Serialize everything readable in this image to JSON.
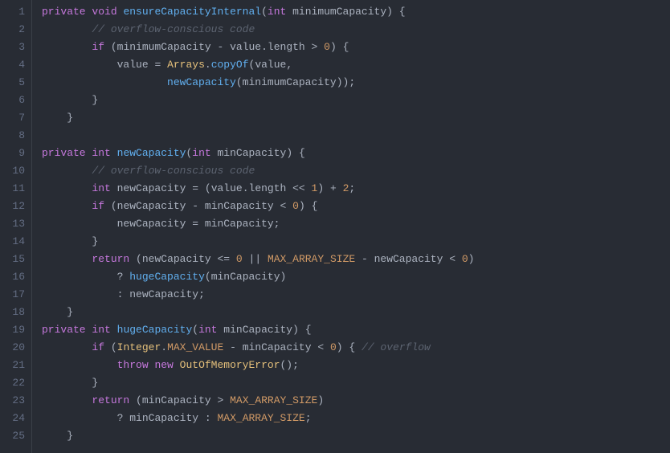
{
  "code": {
    "lines": [
      {
        "t": [
          {
            "c": "kw",
            "s": "private"
          },
          {
            "c": "",
            "s": " "
          },
          {
            "c": "kw",
            "s": "void"
          },
          {
            "c": "",
            "s": " "
          },
          {
            "c": "fn",
            "s": "ensureCapacityInternal"
          },
          {
            "c": "punc",
            "s": "("
          },
          {
            "c": "kw",
            "s": "int"
          },
          {
            "c": "",
            "s": " minimumCapacity"
          },
          {
            "c": "punc",
            "s": ")"
          },
          {
            "c": "",
            "s": " "
          },
          {
            "c": "punc",
            "s": "{"
          }
        ]
      },
      {
        "t": [
          {
            "c": "",
            "s": "        "
          },
          {
            "c": "cmt",
            "s": "// overflow-conscious code"
          }
        ]
      },
      {
        "t": [
          {
            "c": "",
            "s": "        "
          },
          {
            "c": "kw",
            "s": "if"
          },
          {
            "c": "",
            "s": " "
          },
          {
            "c": "punc",
            "s": "("
          },
          {
            "c": "",
            "s": "minimumCapacity "
          },
          {
            "c": "op",
            "s": "-"
          },
          {
            "c": "",
            "s": " value"
          },
          {
            "c": "punc",
            "s": "."
          },
          {
            "c": "",
            "s": "length "
          },
          {
            "c": "op",
            "s": ">"
          },
          {
            "c": "",
            "s": " "
          },
          {
            "c": "num",
            "s": "0"
          },
          {
            "c": "punc",
            "s": ")"
          },
          {
            "c": "",
            "s": " "
          },
          {
            "c": "punc",
            "s": "{"
          }
        ]
      },
      {
        "t": [
          {
            "c": "",
            "s": "            value "
          },
          {
            "c": "op",
            "s": "="
          },
          {
            "c": "",
            "s": " "
          },
          {
            "c": "typename",
            "s": "Arrays"
          },
          {
            "c": "punc",
            "s": "."
          },
          {
            "c": "fn",
            "s": "copyOf"
          },
          {
            "c": "punc",
            "s": "("
          },
          {
            "c": "",
            "s": "value"
          },
          {
            "c": "punc",
            "s": ","
          }
        ]
      },
      {
        "t": [
          {
            "c": "",
            "s": "                    "
          },
          {
            "c": "fn",
            "s": "newCapacity"
          },
          {
            "c": "punc",
            "s": "("
          },
          {
            "c": "",
            "s": "minimumCapacity"
          },
          {
            "c": "punc",
            "s": "))"
          },
          {
            "c": "punc",
            "s": ";"
          }
        ]
      },
      {
        "t": [
          {
            "c": "",
            "s": "        "
          },
          {
            "c": "punc",
            "s": "}"
          }
        ]
      },
      {
        "t": [
          {
            "c": "",
            "s": "    "
          },
          {
            "c": "punc",
            "s": "}"
          }
        ]
      },
      {
        "t": []
      },
      {
        "t": [
          {
            "c": "kw",
            "s": "private"
          },
          {
            "c": "",
            "s": " "
          },
          {
            "c": "kw",
            "s": "int"
          },
          {
            "c": "",
            "s": " "
          },
          {
            "c": "fn",
            "s": "newCapacity"
          },
          {
            "c": "punc",
            "s": "("
          },
          {
            "c": "kw",
            "s": "int"
          },
          {
            "c": "",
            "s": " minCapacity"
          },
          {
            "c": "punc",
            "s": ")"
          },
          {
            "c": "",
            "s": " "
          },
          {
            "c": "punc",
            "s": "{"
          }
        ]
      },
      {
        "t": [
          {
            "c": "",
            "s": "        "
          },
          {
            "c": "cmt",
            "s": "// overflow-conscious code"
          }
        ]
      },
      {
        "t": [
          {
            "c": "",
            "s": "        "
          },
          {
            "c": "kw",
            "s": "int"
          },
          {
            "c": "",
            "s": " newCapacity "
          },
          {
            "c": "op",
            "s": "="
          },
          {
            "c": "",
            "s": " "
          },
          {
            "c": "punc",
            "s": "("
          },
          {
            "c": "",
            "s": "value"
          },
          {
            "c": "punc",
            "s": "."
          },
          {
            "c": "",
            "s": "length "
          },
          {
            "c": "op",
            "s": "<<"
          },
          {
            "c": "",
            "s": " "
          },
          {
            "c": "num",
            "s": "1"
          },
          {
            "c": "punc",
            "s": ")"
          },
          {
            "c": "",
            "s": " "
          },
          {
            "c": "op",
            "s": "+"
          },
          {
            "c": "",
            "s": " "
          },
          {
            "c": "num",
            "s": "2"
          },
          {
            "c": "punc",
            "s": ";"
          }
        ]
      },
      {
        "t": [
          {
            "c": "",
            "s": "        "
          },
          {
            "c": "kw",
            "s": "if"
          },
          {
            "c": "",
            "s": " "
          },
          {
            "c": "punc",
            "s": "("
          },
          {
            "c": "",
            "s": "newCapacity "
          },
          {
            "c": "op",
            "s": "-"
          },
          {
            "c": "",
            "s": " minCapacity "
          },
          {
            "c": "op",
            "s": "<"
          },
          {
            "c": "",
            "s": " "
          },
          {
            "c": "num",
            "s": "0"
          },
          {
            "c": "punc",
            "s": ")"
          },
          {
            "c": "",
            "s": " "
          },
          {
            "c": "punc",
            "s": "{"
          }
        ]
      },
      {
        "t": [
          {
            "c": "",
            "s": "            newCapacity "
          },
          {
            "c": "op",
            "s": "="
          },
          {
            "c": "",
            "s": " minCapacity"
          },
          {
            "c": "punc",
            "s": ";"
          }
        ]
      },
      {
        "t": [
          {
            "c": "",
            "s": "        "
          },
          {
            "c": "punc",
            "s": "}"
          }
        ]
      },
      {
        "t": [
          {
            "c": "",
            "s": "        "
          },
          {
            "c": "kw",
            "s": "return"
          },
          {
            "c": "",
            "s": " "
          },
          {
            "c": "punc",
            "s": "("
          },
          {
            "c": "",
            "s": "newCapacity "
          },
          {
            "c": "op",
            "s": "<="
          },
          {
            "c": "",
            "s": " "
          },
          {
            "c": "num",
            "s": "0"
          },
          {
            "c": "",
            "s": " "
          },
          {
            "c": "op",
            "s": "||"
          },
          {
            "c": "",
            "s": " "
          },
          {
            "c": "const",
            "s": "MAX_ARRAY_SIZE"
          },
          {
            "c": "",
            "s": " "
          },
          {
            "c": "op",
            "s": "-"
          },
          {
            "c": "",
            "s": " newCapacity "
          },
          {
            "c": "op",
            "s": "<"
          },
          {
            "c": "",
            "s": " "
          },
          {
            "c": "num",
            "s": "0"
          },
          {
            "c": "punc",
            "s": ")"
          }
        ]
      },
      {
        "t": [
          {
            "c": "",
            "s": "            "
          },
          {
            "c": "op",
            "s": "?"
          },
          {
            "c": "",
            "s": " "
          },
          {
            "c": "fn",
            "s": "hugeCapacity"
          },
          {
            "c": "punc",
            "s": "("
          },
          {
            "c": "",
            "s": "minCapacity"
          },
          {
            "c": "punc",
            "s": ")"
          }
        ]
      },
      {
        "t": [
          {
            "c": "",
            "s": "            "
          },
          {
            "c": "op",
            "s": ":"
          },
          {
            "c": "",
            "s": " newCapacity"
          },
          {
            "c": "punc",
            "s": ";"
          }
        ]
      },
      {
        "t": [
          {
            "c": "",
            "s": "    "
          },
          {
            "c": "punc",
            "s": "}"
          }
        ]
      },
      {
        "t": [
          {
            "c": "kw",
            "s": "private"
          },
          {
            "c": "",
            "s": " "
          },
          {
            "c": "kw",
            "s": "int"
          },
          {
            "c": "",
            "s": " "
          },
          {
            "c": "fn",
            "s": "hugeCapacity"
          },
          {
            "c": "punc",
            "s": "("
          },
          {
            "c": "kw",
            "s": "int"
          },
          {
            "c": "",
            "s": " minCapacity"
          },
          {
            "c": "punc",
            "s": ")"
          },
          {
            "c": "",
            "s": " "
          },
          {
            "c": "punc",
            "s": "{"
          }
        ]
      },
      {
        "t": [
          {
            "c": "",
            "s": "        "
          },
          {
            "c": "kw",
            "s": "if"
          },
          {
            "c": "",
            "s": " "
          },
          {
            "c": "punc",
            "s": "("
          },
          {
            "c": "typename",
            "s": "Integer"
          },
          {
            "c": "punc",
            "s": "."
          },
          {
            "c": "const",
            "s": "MAX_VALUE"
          },
          {
            "c": "",
            "s": " "
          },
          {
            "c": "op",
            "s": "-"
          },
          {
            "c": "",
            "s": " minCapacity "
          },
          {
            "c": "op",
            "s": "<"
          },
          {
            "c": "",
            "s": " "
          },
          {
            "c": "num",
            "s": "0"
          },
          {
            "c": "punc",
            "s": ")"
          },
          {
            "c": "",
            "s": " "
          },
          {
            "c": "punc",
            "s": "{"
          },
          {
            "c": "",
            "s": " "
          },
          {
            "c": "cmt",
            "s": "// overflow"
          }
        ]
      },
      {
        "t": [
          {
            "c": "",
            "s": "            "
          },
          {
            "c": "kw",
            "s": "throw"
          },
          {
            "c": "",
            "s": " "
          },
          {
            "c": "kw",
            "s": "new"
          },
          {
            "c": "",
            "s": " "
          },
          {
            "c": "typename",
            "s": "OutOfMemoryError"
          },
          {
            "c": "punc",
            "s": "()"
          },
          {
            "c": "punc",
            "s": ";"
          }
        ]
      },
      {
        "t": [
          {
            "c": "",
            "s": "        "
          },
          {
            "c": "punc",
            "s": "}"
          }
        ]
      },
      {
        "t": [
          {
            "c": "",
            "s": "        "
          },
          {
            "c": "kw",
            "s": "return"
          },
          {
            "c": "",
            "s": " "
          },
          {
            "c": "punc",
            "s": "("
          },
          {
            "c": "",
            "s": "minCapacity "
          },
          {
            "c": "op",
            "s": ">"
          },
          {
            "c": "",
            "s": " "
          },
          {
            "c": "const",
            "s": "MAX_ARRAY_SIZE"
          },
          {
            "c": "punc",
            "s": ")"
          }
        ]
      },
      {
        "t": [
          {
            "c": "",
            "s": "            "
          },
          {
            "c": "op",
            "s": "?"
          },
          {
            "c": "",
            "s": " minCapacity "
          },
          {
            "c": "op",
            "s": ":"
          },
          {
            "c": "",
            "s": " "
          },
          {
            "c": "const",
            "s": "MAX_ARRAY_SIZE"
          },
          {
            "c": "punc",
            "s": ";"
          }
        ]
      },
      {
        "t": [
          {
            "c": "",
            "s": "    "
          },
          {
            "c": "punc",
            "s": "}"
          }
        ]
      }
    ]
  }
}
